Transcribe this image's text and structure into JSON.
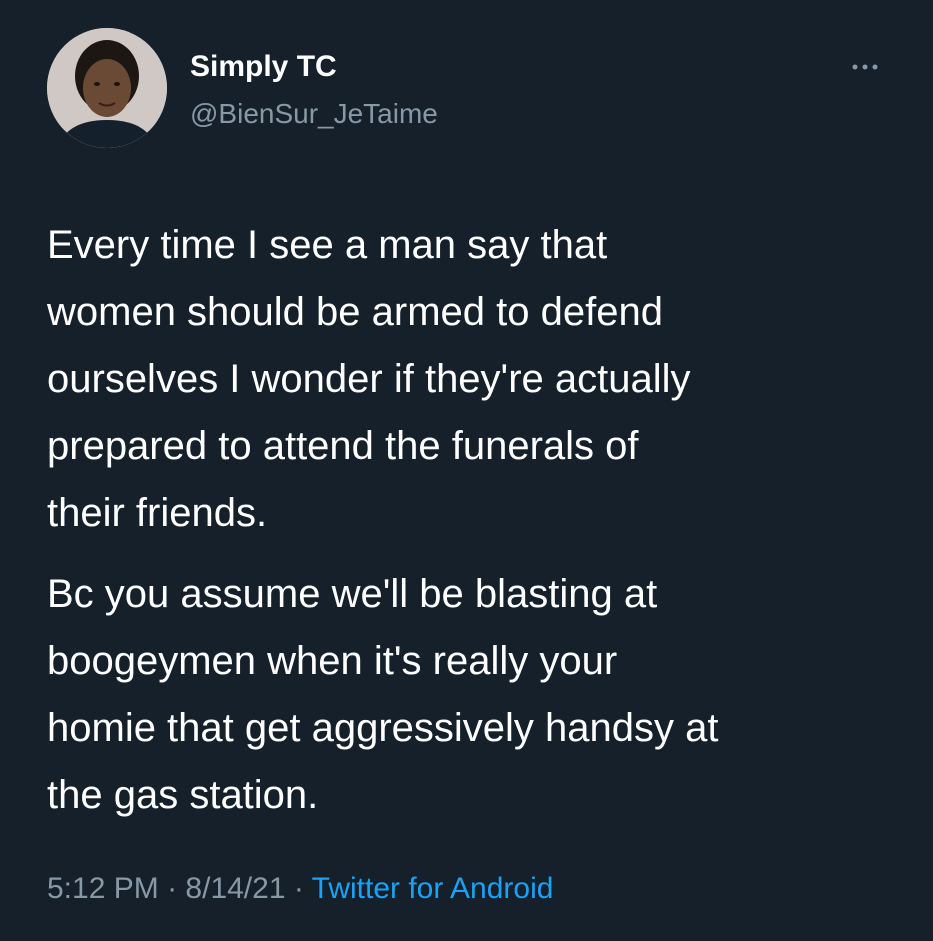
{
  "author": {
    "display_name": "Simply TC",
    "handle": "@BienSur_JeTaime",
    "avatar_icon": "profile-photo"
  },
  "menu": {
    "icon": "more-horizontal-icon"
  },
  "tweet": {
    "paragraph_1_lines": [
      "Every time I see a man say that",
      "women should be armed to defend",
      "ourselves I wonder if they're actually",
      "prepared to attend the funerals of",
      "their friends."
    ],
    "paragraph_2_lines": [
      "Bc you assume we'll be blasting at",
      "boogeymen when it's really your",
      "homie that get aggressively handsy at",
      "the gas station."
    ]
  },
  "meta": {
    "time": "5:12 PM",
    "separator": "·",
    "date": "8/14/21",
    "source": "Twitter for Android"
  },
  "colors": {
    "background": "#15202b",
    "text": "#ffffff",
    "secondary_text": "#8899a6",
    "link": "#1da1f2"
  }
}
